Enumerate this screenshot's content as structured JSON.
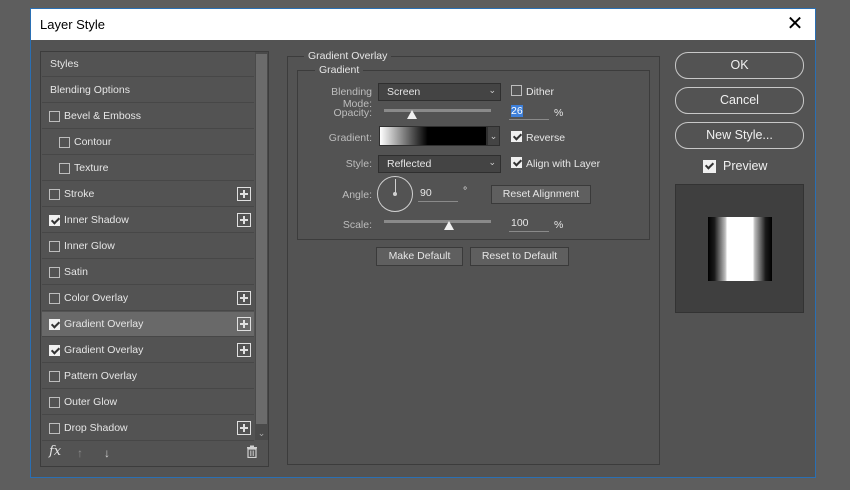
{
  "window": {
    "title": "Layer Style",
    "close_glyph": "✕"
  },
  "styles_panel": {
    "items": [
      {
        "label": "Styles",
        "checkbox": false,
        "checked": false,
        "plus": false,
        "indent": 0,
        "selected": false
      },
      {
        "label": "Blending Options",
        "checkbox": false,
        "checked": false,
        "plus": false,
        "indent": 0,
        "selected": false
      },
      {
        "label": "Bevel & Emboss",
        "checkbox": true,
        "checked": false,
        "plus": false,
        "indent": 0,
        "selected": false
      },
      {
        "label": "Contour",
        "checkbox": true,
        "checked": false,
        "plus": false,
        "indent": 1,
        "selected": false
      },
      {
        "label": "Texture",
        "checkbox": true,
        "checked": false,
        "plus": false,
        "indent": 1,
        "selected": false
      },
      {
        "label": "Stroke",
        "checkbox": true,
        "checked": false,
        "plus": true,
        "indent": 0,
        "selected": false
      },
      {
        "label": "Inner Shadow",
        "checkbox": true,
        "checked": true,
        "plus": true,
        "indent": 0,
        "selected": false
      },
      {
        "label": "Inner Glow",
        "checkbox": true,
        "checked": false,
        "plus": false,
        "indent": 0,
        "selected": false
      },
      {
        "label": "Satin",
        "checkbox": true,
        "checked": false,
        "plus": false,
        "indent": 0,
        "selected": false
      },
      {
        "label": "Color Overlay",
        "checkbox": true,
        "checked": false,
        "plus": true,
        "indent": 0,
        "selected": false
      },
      {
        "label": "Gradient Overlay",
        "checkbox": true,
        "checked": true,
        "plus": true,
        "indent": 0,
        "selected": true
      },
      {
        "label": "Gradient Overlay",
        "checkbox": true,
        "checked": true,
        "plus": true,
        "indent": 0,
        "selected": false
      },
      {
        "label": "Pattern Overlay",
        "checkbox": true,
        "checked": false,
        "plus": false,
        "indent": 0,
        "selected": false
      },
      {
        "label": "Outer Glow",
        "checkbox": true,
        "checked": false,
        "plus": false,
        "indent": 0,
        "selected": false
      },
      {
        "label": "Drop Shadow",
        "checkbox": true,
        "checked": false,
        "plus": true,
        "indent": 0,
        "selected": false
      }
    ],
    "footer": {
      "fx_label": "fx",
      "up_glyph": "↑",
      "down_glyph": "↓",
      "trash_glyph": "␡"
    }
  },
  "panel": {
    "section_title": "Gradient Overlay",
    "group_title": "Gradient",
    "blend_mode": {
      "label": "Blending Mode:",
      "value": "Screen"
    },
    "dither": {
      "label": "Dither",
      "checked": false
    },
    "opacity": {
      "label": "Opacity:",
      "value": "26",
      "unit": "%",
      "level": 26
    },
    "gradient": {
      "label": "Gradient:"
    },
    "reverse": {
      "label": "Reverse",
      "checked": true
    },
    "style": {
      "label": "Style:",
      "value": "Reflected"
    },
    "align_with_layer": {
      "label": "Align with Layer",
      "checked": true
    },
    "angle": {
      "label": "Angle:",
      "value": "90",
      "unit": "°"
    },
    "reset_alignment": "Reset Alignment",
    "scale": {
      "label": "Scale:",
      "value": "100",
      "unit": "%",
      "level": 100
    },
    "make_default": "Make Default",
    "reset_to_default": "Reset to Default"
  },
  "actions": {
    "ok": "OK",
    "cancel": "Cancel",
    "new_style": "New Style...",
    "preview": {
      "label": "Preview",
      "checked": true
    }
  },
  "colors": {
    "accent": "#3d7fd9",
    "panel_bg": "#535353"
  }
}
